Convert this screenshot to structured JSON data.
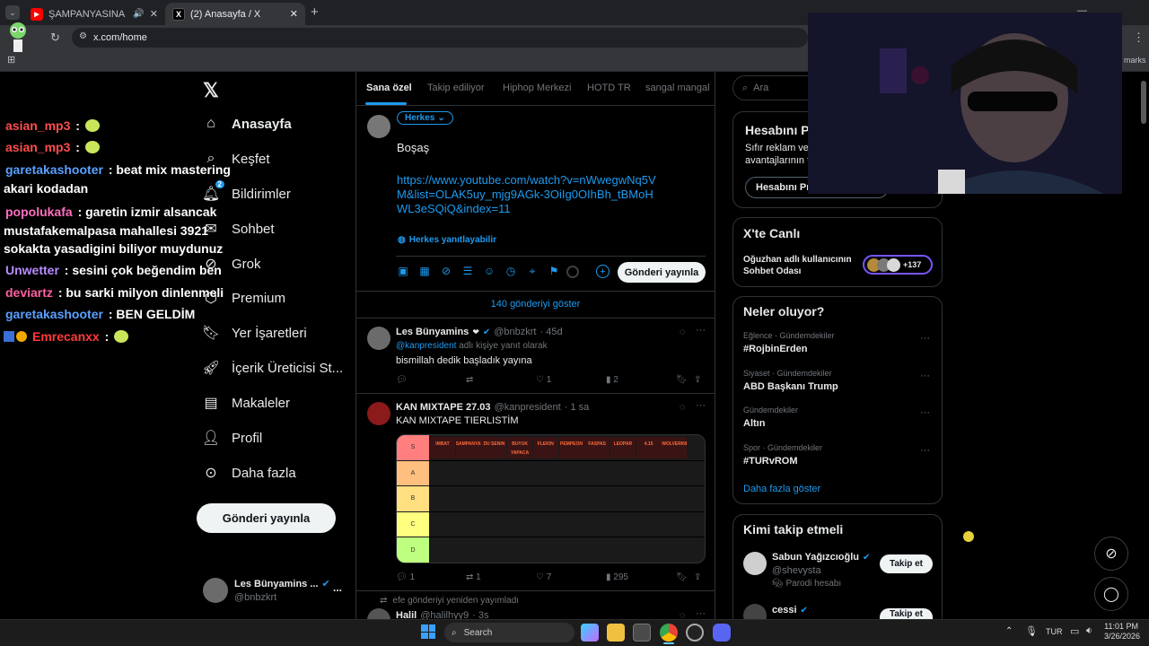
{
  "browser": {
    "tabs": [
      {
        "title": "ŞAMPANYASINA (feat. Akı",
        "icon": "youtube-icon",
        "audio": true
      },
      {
        "title": "(2) Anasayfa / X",
        "icon": "x-icon",
        "active": true
      }
    ],
    "new_tab": "+",
    "url": "x.com/home",
    "bookmarks_text": "marks"
  },
  "chat": [
    {
      "user": "asian_mp3",
      "user_color": "#ff4d4d",
      "msg": ":",
      "emote": "emote"
    },
    {
      "user": "asian_mp3",
      "user_color": "#ff4d4d",
      "msg": ":",
      "emote": "emote"
    },
    {
      "user": "garetakashooter",
      "user_color": "#5aa0ff",
      "msg": ": beat mix mastering"
    },
    {
      "user": "",
      "msg": "akari kodadan"
    },
    {
      "user": "popolukafa",
      "user_color": "#ff6fbf",
      "msg": ": garetin izmir alsancak"
    },
    {
      "user": "",
      "msg": "mustafakemalpasa mahallesi 3921"
    },
    {
      "user": "",
      "msg": "sokakta yasadigini biliyor muydunuz"
    },
    {
      "user": "Unwetter",
      "user_color": "#b78cff",
      "msg": ": sesini çok beğendim ben"
    },
    {
      "user": "deviartz",
      "user_color": "#ff5fa0",
      "msg": ": bu sarki milyon dinlenmeli"
    },
    {
      "user": "garetakashooter",
      "user_color": "#5aa0ff",
      "msg": ": BEN GELDİM"
    },
    {
      "user": "Emrecanxx",
      "user_color": "#ff3b3b",
      "msg": ":",
      "emote": "emote"
    }
  ],
  "nav": {
    "logo": "X",
    "items": [
      {
        "label": "Anasayfa",
        "icon": "home-icon",
        "bold": true
      },
      {
        "label": "Keşfet",
        "icon": "search-icon"
      },
      {
        "label": "Bildirimler",
        "icon": "bell-icon",
        "badge": "2"
      },
      {
        "label": "Sohbet",
        "icon": "mail-icon"
      },
      {
        "label": "Grok",
        "icon": "grok-icon"
      },
      {
        "label": "Premium",
        "icon": "premium-icon"
      },
      {
        "label": "Yer İşaretleri",
        "icon": "bookmark-icon"
      },
      {
        "label": "İçerik Üreticisi St...",
        "icon": "rocket-icon"
      },
      {
        "label": "Makaleler",
        "icon": "article-icon"
      },
      {
        "label": "Profil",
        "icon": "person-icon"
      },
      {
        "label": "Daha fazla",
        "icon": "more-circle-icon"
      }
    ],
    "post_button": "Gönderi yayınla",
    "account": {
      "name": "Les Bünyamins ...",
      "handle": "@bnbzkrt",
      "more": "..."
    }
  },
  "feed": {
    "tabs": [
      "Sana özel",
      "Takip ediliyor",
      "Hiphop Merkezi",
      "HOTD TR",
      "sangal mangal"
    ],
    "composer": {
      "audience": "Herkes",
      "text": "Boşaş",
      "link": "https://www.youtube.com/watch?v=nWwegwNq5VM&list=OLAK5uy_mjg9AGk-3OiIg0OIhBh_tBMoHWL3eSQiQ&index=11",
      "reply_setting": "Herkes yanıtlayabilir",
      "post_button": "Gönderi yayınla"
    },
    "show_more": "140 gönderiyi göster",
    "posts": [
      {
        "name": "Les Bünyamins",
        "handle": "@bnbzkrt",
        "time": "· 45d",
        "reply_to_user": "@kanpresident",
        "reply_to_suffix": "adlı kişiye yanıt olarak",
        "text": "bismillah dedik başladık yayına",
        "replies": "",
        "reposts": "",
        "likes": "1",
        "views": "2"
      },
      {
        "name": "KAN MIXTAPE 27.03",
        "handle": "@kanpresident",
        "time": "· 1 sa",
        "text": "KAN MIXTAPE TIERLISTİM",
        "tierlist": {
          "rows": [
            "S",
            "A",
            "B",
            "C",
            "D"
          ],
          "row_colors": [
            "#ff7f7f",
            "#ffbf7f",
            "#ffdf7f",
            "#ffff7f",
            "#bfff7f"
          ],
          "s_items": [
            "IMBAT",
            "SAMPANYASINA",
            "DU SENIN",
            "BUYUK YAPACA",
            "FLEKIN",
            "PEMPEON",
            "FASPAS",
            "LEOPAR",
            "4.15",
            "WOLVERINE"
          ]
        },
        "replies": "1",
        "reposts": "1",
        "likes": "7",
        "views": "295"
      },
      {
        "repost_note": "efe gönderiyi yeniden yayımladı",
        "name": "Halil",
        "handle": "@halilhyy9",
        "time": "· 3s"
      }
    ]
  },
  "right": {
    "search_placeholder": "Ara",
    "premium": {
      "title": "Hesabını P",
      "text1": "Sıfır reklam ve e",
      "text2": "avantajlarının ta",
      "button": "Hesabını Pre"
    },
    "live": {
      "title": "X'te Canlı",
      "line1": "Oğuzhan adlı kullanıcının",
      "line2": "Sohbet Odası",
      "count": "+137"
    },
    "trends_title": "Neler oluyor?",
    "trends": [
      {
        "meta": "Eğlence · Gündemdekiler",
        "name": "#RojbinErden"
      },
      {
        "meta": "Siyaset · Gündemdekiler",
        "name": "ABD Başkanı Trump"
      },
      {
        "meta": "Gündemdekiler",
        "name": "Altın"
      },
      {
        "meta": "Spor · Gündemdekiler",
        "name": "#TURvROM"
      }
    ],
    "trends_more": "Daha fazla göster",
    "follow_title": "Kimi takip etmeli",
    "follows": [
      {
        "name": "Sabun Yağızcıoğlu",
        "handle": "@shevysta",
        "note": "Parodi hesabı",
        "button": "Takip et"
      },
      {
        "name": "cessi",
        "handle": "",
        "button": "Takip et"
      }
    ]
  },
  "taskbar": {
    "search": "Search",
    "lang": "TUR",
    "time": "11:01 PM",
    "date": "3/26/2026"
  }
}
